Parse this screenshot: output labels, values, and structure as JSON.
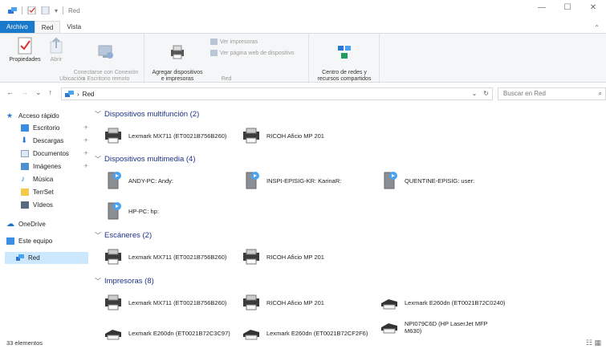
{
  "window": {
    "title": "Red",
    "controls": {
      "minimize": "—",
      "maximize": "☐",
      "close": "✕"
    }
  },
  "ribbon_tabs": [
    {
      "label": "Archivo"
    },
    {
      "label": "Red"
    },
    {
      "label": "Vista"
    }
  ],
  "ribbon": {
    "collapse_caret": "⌃",
    "groups": {
      "ubicacion": {
        "label": "Ubicación",
        "buttons": {
          "propiedades": "Propiedades",
          "abrir": "Abrir",
          "conectarse": "Conectarse con Conexión\na Escritorio remoto"
        }
      },
      "red": {
        "label": "Red",
        "buttons": {
          "agregar": "Agregar dispositivos\ne impresoras",
          "ver_impresoras": "Ver impresoras",
          "ver_pagina": "Ver página web de dispositivo"
        }
      },
      "centro": {
        "buttons": {
          "centro_redes": "Centro de redes y\nrecursos compartidos"
        }
      }
    }
  },
  "addressbar": {
    "back": "←",
    "forward": "→",
    "recent": "⌄",
    "up": "↑",
    "separator": "›",
    "path": "Red",
    "dropdown": "⌄",
    "refresh": "↻",
    "search_placeholder": "Buscar en Red",
    "search_icon": "⌕"
  },
  "nav": {
    "quick_access": "Acceso rápido",
    "items": [
      {
        "label": "Escritorio",
        "pinned": true
      },
      {
        "label": "Descargas",
        "pinned": true
      },
      {
        "label": "Documentos",
        "pinned": true
      },
      {
        "label": "Imágenes",
        "pinned": true
      },
      {
        "label": "Música",
        "pinned": false
      },
      {
        "label": "TerrSet",
        "pinned": false
      },
      {
        "label": "Vídeos",
        "pinned": false
      }
    ],
    "onedrive": "OneDrive",
    "este_equipo": "Este equipo",
    "red": "Red",
    "pin_glyph": "✈"
  },
  "groups": [
    {
      "header": "Dispositivos multifunción (2)",
      "items": [
        {
          "label": "Lexmark MX711 (ET0021B756B260)"
        },
        {
          "label": "RICOH Aficio MP 201"
        }
      ]
    },
    {
      "header": "Dispositivos multimedia (4)",
      "items": [
        {
          "label": "ANDY-PC: Andy:"
        },
        {
          "label": "INSPI-EPISIG-KR: KarinaR:"
        },
        {
          "label": "QUENTINE-EPISIG: user:"
        },
        {
          "label": "HP-PC: hp:"
        }
      ]
    },
    {
      "header": "Escáneres (2)",
      "items": [
        {
          "label": "Lexmark MX711 (ET0021B756B260)"
        },
        {
          "label": "RICOH Aficio MP 201"
        }
      ]
    },
    {
      "header": "Impresoras (8)",
      "items": [
        {
          "label": "Lexmark MX711 (ET0021B756B260)"
        },
        {
          "label": "RICOH Aficio MP 201"
        },
        {
          "label": "Lexmark E260dn (ET0021B72C0240)"
        },
        {
          "label": "Lexmark E260dn (ET0021B72C3C97)"
        },
        {
          "label": "Lexmark E260dn (ET0021B72CF2F6)"
        },
        {
          "label": "NPI079C6D (HP LaserJet MFP M630)"
        }
      ]
    }
  ],
  "status": {
    "count": "33 elementos",
    "views": "☷ ▦"
  },
  "colors": {
    "accent": "#1979ca",
    "header_text": "#1e3287",
    "selection": "#cce8ff"
  }
}
